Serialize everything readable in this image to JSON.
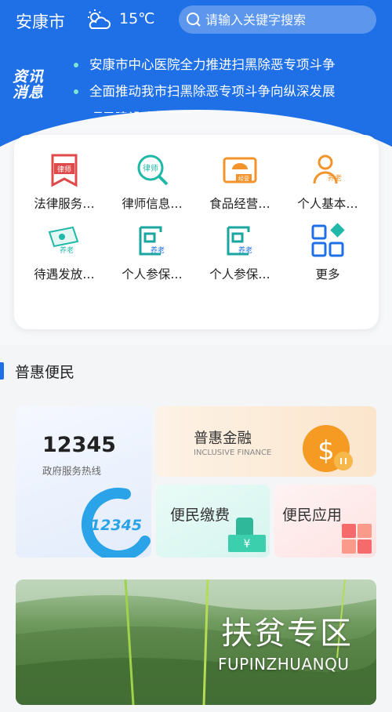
{
  "header": {
    "city": "安康市",
    "weather_icon": "partly-cloudy-icon",
    "temperature": "15℃",
    "search_placeholder": "请输入关键字搜索"
  },
  "news": {
    "logo_line1": "资讯",
    "logo_line2": "消息",
    "items": [
      "安康市中心医院全力推进扫黑除恶专项斗争",
      "全面推动我市扫黑除恶专项斗争向纵深发展",
      "项目建设成效显著"
    ]
  },
  "services": [
    {
      "label": "法律服务…",
      "icon": "lawyer-bookmark-icon",
      "badge": "律师"
    },
    {
      "label": "律师信息…",
      "icon": "lawyer-search-icon",
      "badge": "律师"
    },
    {
      "label": "食品经营…",
      "icon": "food-business-icon",
      "badge": "经营"
    },
    {
      "label": "个人基本…",
      "icon": "person-pension-icon",
      "badge": "养老"
    },
    {
      "label": "待遇发放…",
      "icon": "money-pension-icon",
      "badge": "养老"
    },
    {
      "label": "个人参保…",
      "icon": "insurance-pension-icon",
      "badge": "养老"
    },
    {
      "label": "个人参保…",
      "icon": "insurance-pension-icon",
      "badge": "养老"
    },
    {
      "label": "更多",
      "icon": "more-grid-icon",
      "badge": ""
    }
  ],
  "section": {
    "title": "普惠便民"
  },
  "tiles": {
    "hotline_number": "12345",
    "hotline_label": "政府服务热线",
    "hotline_logo_text": "12345",
    "finance_title": "普惠金融",
    "finance_en": "INCLUSIVE FINANCE",
    "pay_title": "便民缴费",
    "app_title": "便民应用"
  },
  "poverty": {
    "title": "扶贫专区",
    "subtitle": "FUPINZHUANQU"
  },
  "colors": {
    "brand_blue": "#1f6fe6",
    "accent_orange": "#f2932b",
    "accent_teal": "#20b8a8"
  }
}
